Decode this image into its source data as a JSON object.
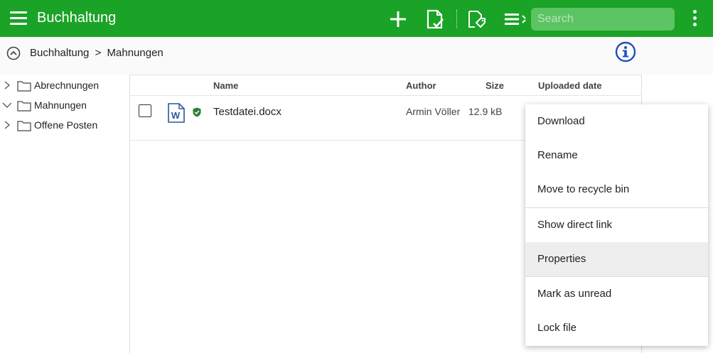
{
  "app": {
    "title": "Buchhaltung"
  },
  "toolbar": {
    "search_placeholder": "Search",
    "icons": [
      "menu-icon",
      "add-icon",
      "document-check-icon",
      "document-tag-icon",
      "list-settings-icon",
      "more-vertical-icon"
    ],
    "accent_color": "#1aa326"
  },
  "breadcrumb": {
    "root": "Buchhaltung",
    "separator": ">",
    "current": "Mahnungen"
  },
  "sidebar": {
    "items": [
      {
        "label": "Abrechnungen",
        "expanded": false
      },
      {
        "label": "Mahnungen",
        "expanded": true
      },
      {
        "label": "Offene Posten",
        "expanded": false
      }
    ]
  },
  "table": {
    "columns": {
      "name": "Name",
      "author": "Author",
      "size": "Size",
      "uploaded": "Uploaded date"
    },
    "rows": [
      {
        "name": "Testdatei.docx",
        "author": "Armin Völler",
        "size": "12.9 kB",
        "file_icon": "word-document-icon",
        "status_icon": "shield-check-icon"
      }
    ]
  },
  "context_menu": {
    "items": [
      {
        "label": "Download"
      },
      {
        "label": "Rename"
      },
      {
        "label": "Move to recycle bin"
      },
      {
        "label": "Show direct link"
      },
      {
        "label": "Properties",
        "highlighted": true
      },
      {
        "label": "Mark as unread"
      },
      {
        "label": "Lock file"
      }
    ]
  }
}
